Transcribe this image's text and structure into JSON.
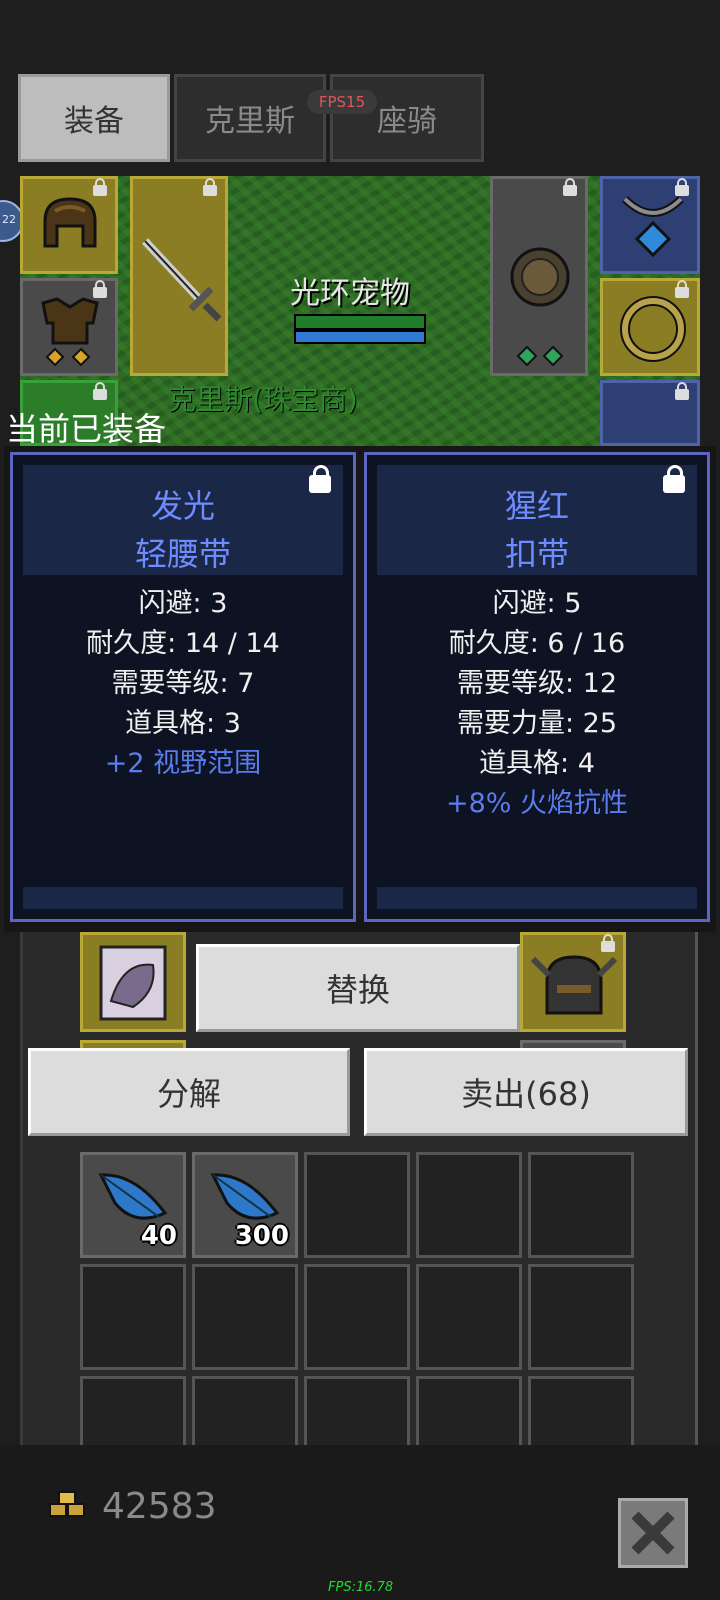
{
  "tabs": [
    {
      "label": "装备",
      "active": true
    },
    {
      "label": "克里斯",
      "active": false
    },
    {
      "label": "座骑",
      "active": false
    }
  ],
  "fps_badge": "FPS15",
  "avatar_badge": "22",
  "scene": {
    "pet_name": "光环宠物",
    "character_name": "克里斯(珠宝商)"
  },
  "equipped_label": "当前已装备",
  "panels": [
    {
      "prefix": "发光",
      "name": "轻腰带",
      "stats": [
        "闪避: 3",
        "耐久度: 14 / 14",
        "需要等级: 7",
        "道具格: 3"
      ],
      "bonus": "+2 视野范围"
    },
    {
      "prefix": "猩红",
      "name": "扣带",
      "stats": [
        "闪避: 5",
        "耐久度: 6 / 16",
        "需要等级: 12",
        "需要力量: 25",
        "道具格: 4"
      ],
      "bonus": "+8% 火焰抗性"
    }
  ],
  "buttons": {
    "replace": "替换",
    "salvage": "分解",
    "sell": "卖出(68)"
  },
  "inventory": {
    "feather_1_qty": "40",
    "feather_2_qty": "300"
  },
  "gold": "42583",
  "fps_bottom": "FPS:16.78",
  "colors": {
    "panel_title": "#6d8cff",
    "bonus_text": "#5b7cf0",
    "fps_badge_text": "#e25555",
    "fps_bottom_text": "#23d82f"
  }
}
